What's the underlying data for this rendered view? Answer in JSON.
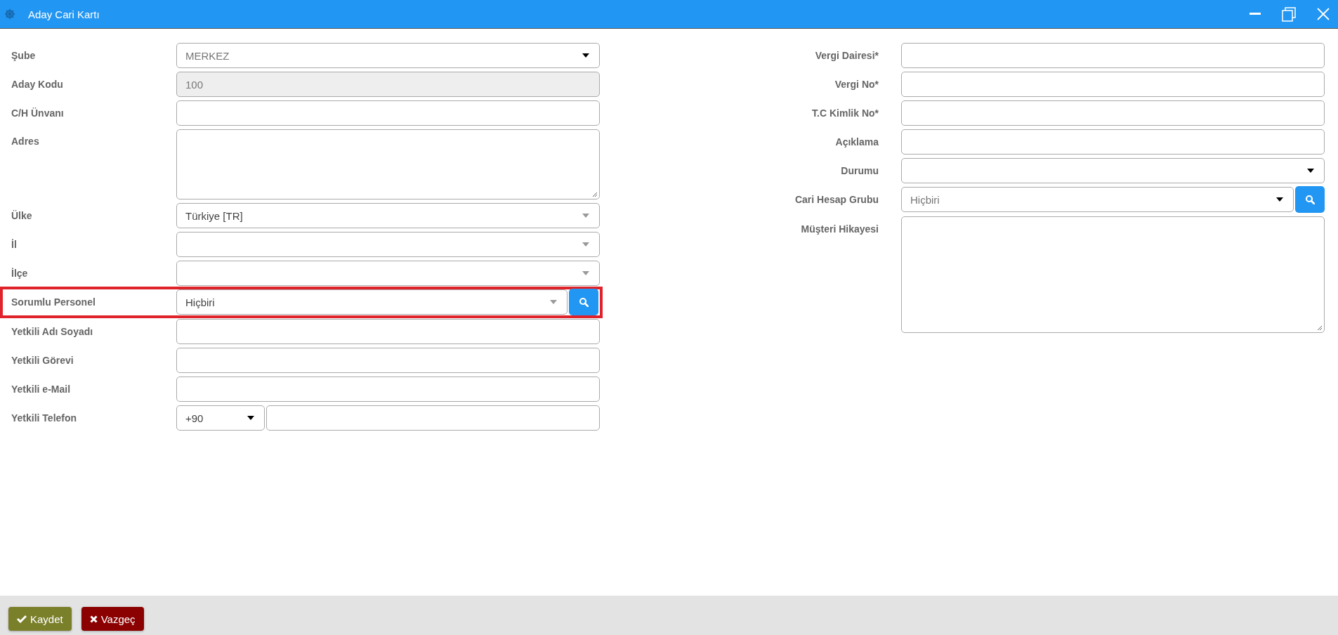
{
  "window": {
    "title": "Aday Cari Kartı"
  },
  "left_fields": [
    {
      "label": "Şube",
      "kind": "select",
      "value": "MERKEZ",
      "search": false,
      "highlighted": false
    },
    {
      "label": "Aday Kodu",
      "kind": "readonly",
      "value": "100",
      "search": false,
      "highlighted": false
    },
    {
      "label": "C/H Ünvanı",
      "kind": "text",
      "search": false,
      "highlighted": false
    },
    {
      "label": "Adres",
      "kind": "textarea",
      "search": false,
      "highlighted": false
    },
    {
      "label": "Ülke",
      "kind": "combo",
      "value": "Türkiye [TR]",
      "search": false,
      "highlighted": false
    },
    {
      "label": "İl",
      "kind": "combo",
      "search": false,
      "highlighted": false
    },
    {
      "label": "İlçe",
      "kind": "combo",
      "search": false,
      "highlighted": false
    },
    {
      "label": "Sorumlu Personel",
      "kind": "combo",
      "value": "Hiçbiri",
      "search": true,
      "highlighted": true
    },
    {
      "label": "Yetkili Adı Soyadı",
      "kind": "text",
      "search": false,
      "highlighted": false
    },
    {
      "label": "Yetkili Görevi",
      "kind": "text",
      "search": false,
      "highlighted": false
    },
    {
      "label": "Yetkili e-Mail",
      "kind": "text",
      "search": false,
      "highlighted": false
    },
    {
      "label": "Yetkili Telefon",
      "kind": "phone",
      "code": "+90",
      "search": false,
      "highlighted": false
    }
  ],
  "right_fields": [
    {
      "label": "Vergi Dairesi*",
      "kind": "text",
      "search": false,
      "highlighted": false
    },
    {
      "label": "Vergi No*",
      "kind": "text",
      "search": false,
      "highlighted": false
    },
    {
      "label": "T.C Kimlik No*",
      "kind": "text",
      "search": false,
      "highlighted": false
    },
    {
      "label": "Açıklama",
      "kind": "text",
      "search": false,
      "highlighted": false
    },
    {
      "label": "Durumu",
      "kind": "select",
      "search": false,
      "highlighted": false
    },
    {
      "label": "Cari Hesap Grubu",
      "kind": "select",
      "value": "Hiçbiri",
      "search": true,
      "highlighted": false
    },
    {
      "label": "Müşteri Hikayesi",
      "kind": "textarea",
      "search": false,
      "highlighted": false
    }
  ],
  "buttons": [
    {
      "label": "Kaydet",
      "kind": "save"
    },
    {
      "label": "Vazgeç",
      "kind": "cancel"
    }
  ]
}
